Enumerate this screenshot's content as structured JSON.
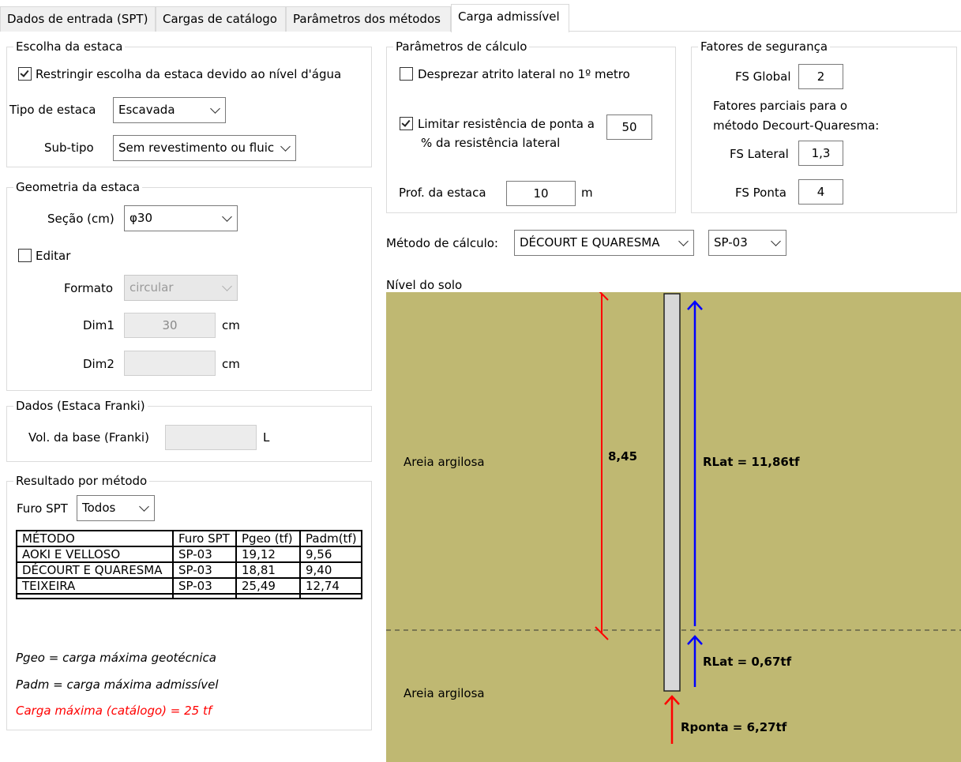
{
  "tabs": [
    {
      "label": "Dados de entrada (SPT)"
    },
    {
      "label": "Cargas de catálogo"
    },
    {
      "label": "Parâmetros dos métodos"
    },
    {
      "label": "Carga admissível"
    }
  ],
  "escolha": {
    "title": "Escolha da estaca",
    "restringir_label": "Restringir escolha da estaca devido ao nível d'água",
    "restringir_checked": true,
    "tipo_label": "Tipo de estaca",
    "tipo_value": "Escavada",
    "subtipo_label": "Sub-tipo",
    "subtipo_value": "Sem revestimento ou fluic"
  },
  "geometria": {
    "title": "Geometria da estaca",
    "secao_label": "Seção (cm)",
    "secao_value": "φ30",
    "editar_label": "Editar",
    "editar_checked": false,
    "formato_label": "Formato",
    "formato_value": "circular",
    "dim1_label": "Dim1",
    "dim1_value": "30",
    "dim1_unit": "cm",
    "dim2_label": "Dim2",
    "dim2_value": "",
    "dim2_unit": "cm"
  },
  "franki": {
    "title": "Dados (Estaca Franki)",
    "vol_label": "Vol. da base (Franki)",
    "vol_value": "",
    "vol_unit": "L"
  },
  "resultado": {
    "title": "Resultado por método",
    "furo_label": "Furo SPT",
    "furo_value": "Todos",
    "columns": [
      "MÉTODO",
      "Furo SPT",
      "Pgeo (tf)",
      "Padm(tf)"
    ],
    "rows": [
      [
        "AOKI E VELLOSO",
        "SP-03",
        "19,12",
        "9,56"
      ],
      [
        "DÉCOURT E QUARESMA",
        "SP-03",
        "18,81",
        "9,40"
      ],
      [
        "TEIXEIRA",
        "SP-03",
        "25,49",
        "12,74"
      ]
    ],
    "note_pgeo": "Pgeo = carga máxima geotécnica",
    "note_padm": "Padm = carga máxima admissível",
    "note_carga": "Carga máxima (catálogo) = 25 tf",
    "note_carga_color": "#ff0000"
  },
  "parametros": {
    "title": "Parâmetros de cálculo",
    "desprezar_label": "Desprezar atrito lateral no 1º metro",
    "desprezar_checked": false,
    "limitar_label_1": "Limitar resistência de ponta a",
    "limitar_label_2": "% da resistência lateral",
    "limitar_checked": true,
    "limitar_value": "50",
    "prof_label": "Prof. da estaca",
    "prof_value": "10",
    "prof_unit": "m"
  },
  "fatores": {
    "title": "Fatores de segurança",
    "fs_global_label": "FS Global",
    "fs_global_value": "2",
    "parciais_label_1": "Fatores parciais para o",
    "parciais_label_2": "método Decourt-Quaresma:",
    "fs_lateral_label": "FS Lateral",
    "fs_lateral_value": "1,3",
    "fs_ponta_label": "FS Ponta",
    "fs_ponta_value": "4"
  },
  "metodo": {
    "label": "Método de cálculo:",
    "value": "DÉCOURT E QUARESMA",
    "furo_value": "SP-03"
  },
  "diagram": {
    "nivel_label": "Nível do solo",
    "layer1_label": "Areia argilosa",
    "layer2_label": "Areia argilosa",
    "depth_label": "8,45",
    "rlat1_label": "RLat = 11,86tf",
    "rlat2_label": "RLat = 0,67tf",
    "rponta_label": "Rponta = 6,27tf",
    "soil_color": "#bfb872",
    "red_arrow_color": "#ff0000",
    "blue_arrow_color": "#0000ff",
    "pile_color": "#d8d8d8"
  }
}
